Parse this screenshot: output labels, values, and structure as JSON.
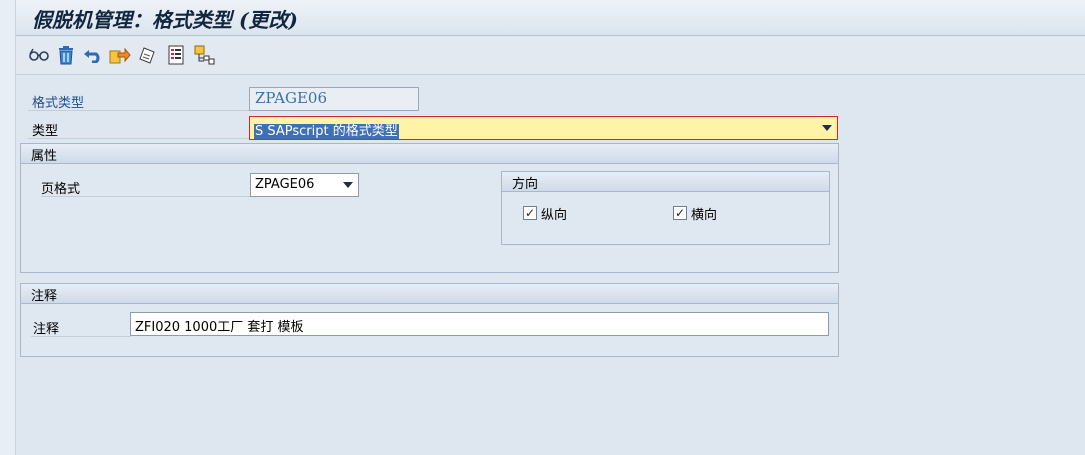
{
  "title": "假脱机管理：格式类型 (更改)",
  "toolbar": {
    "icons": [
      "glasses-icon",
      "trash-icon",
      "undo-icon",
      "transfer-icon",
      "edit-icon",
      "list-icon",
      "hierarchy-icon"
    ]
  },
  "form": {
    "format_type_label": "格式类型",
    "format_type_value": "ZPAGE06",
    "type_label": "类型",
    "type_value": "S SAPscript 的格式类型"
  },
  "attributes": {
    "header": "属性",
    "page_format_label": "页格式",
    "page_format_value": "ZPAGE06",
    "orientation": {
      "header": "方向",
      "portrait_label": "纵向",
      "portrait_checked": true,
      "landscape_label": "横向",
      "landscape_checked": true
    }
  },
  "comments": {
    "header": "注释",
    "comment_label": "注释",
    "comment_value": "ZFI020 1000工厂 套打 模板"
  },
  "colors": {
    "title_text": "#12263f",
    "highlight_field": "#fff3a8",
    "focus_bracket": "#d9262b",
    "selection": "#3f6fb5"
  }
}
